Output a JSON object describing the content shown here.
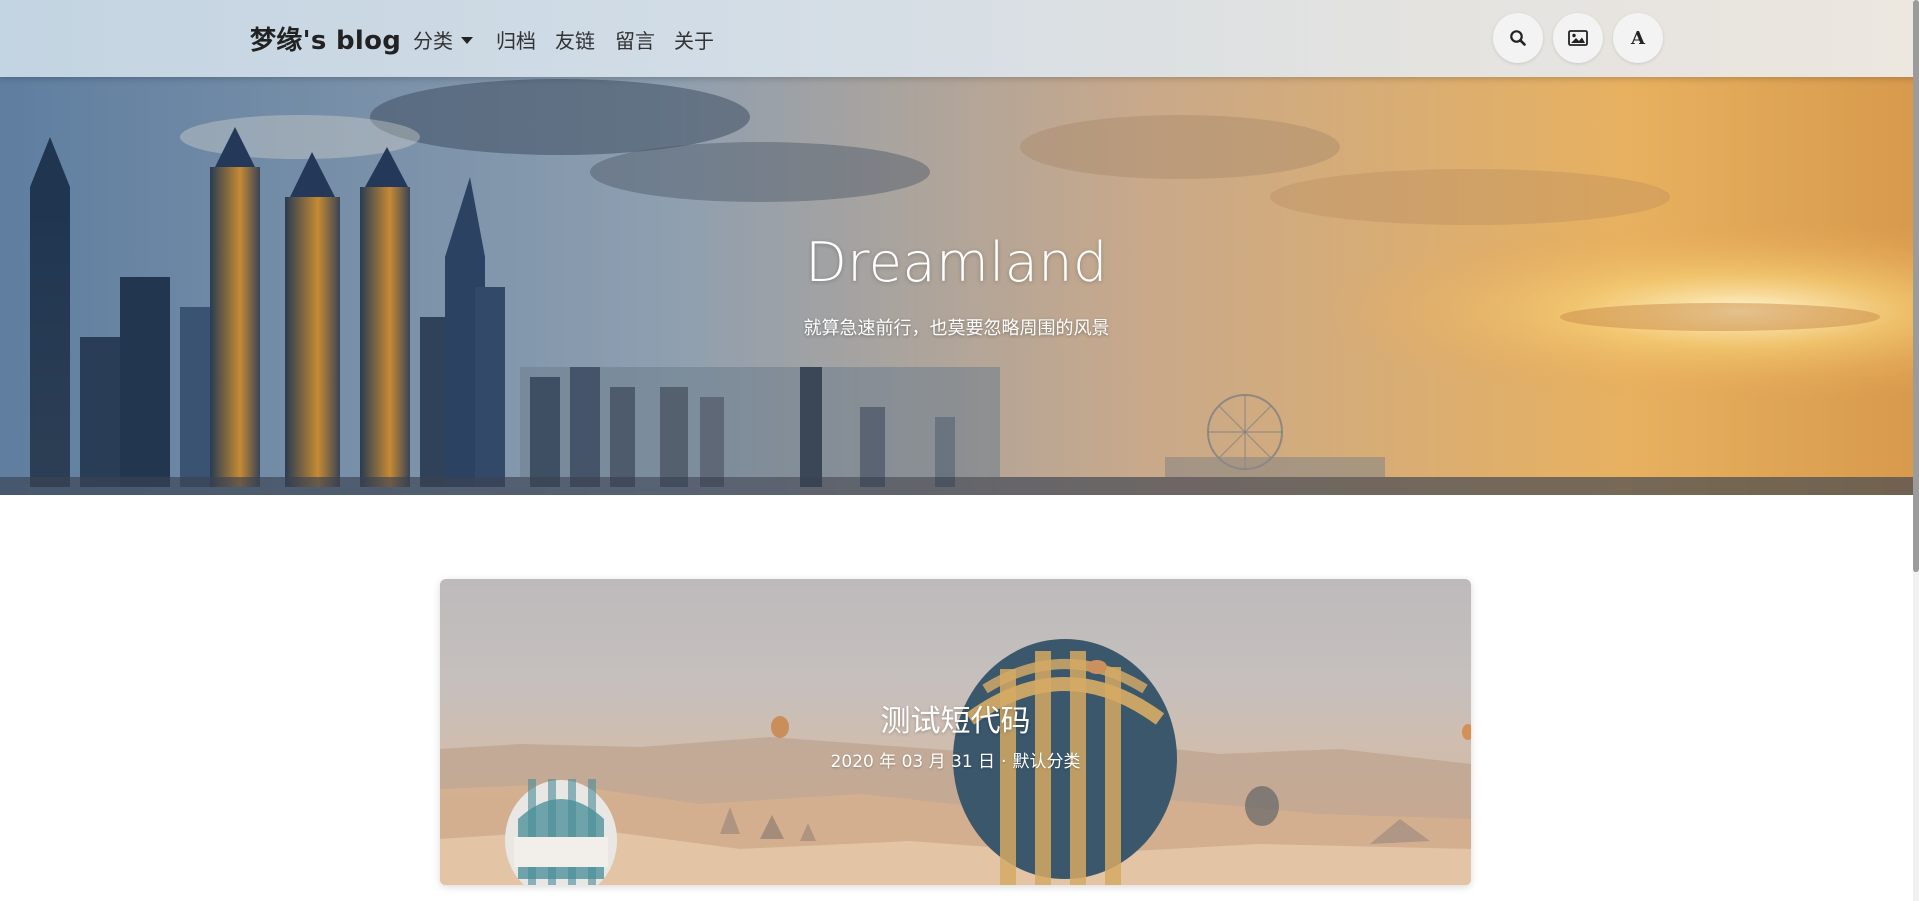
{
  "navbar": {
    "brand": "梦缘's blog",
    "items": [
      {
        "label": "分类",
        "has_dropdown": true
      },
      {
        "label": "归档"
      },
      {
        "label": "友链"
      },
      {
        "label": "留言"
      },
      {
        "label": "关于"
      }
    ],
    "buttons": {
      "search_icon": "search-icon",
      "image_icon": "image-icon",
      "font_label": "A"
    }
  },
  "hero": {
    "title": "Dreamland",
    "subtitle": "就算急速前行，也莫要忽略周围的风景"
  },
  "posts": [
    {
      "title": "测试短代码",
      "date": "2020 年 03 月 31 日",
      "separator": "·",
      "category": "默认分类"
    }
  ],
  "colors": {
    "text_dark": "#222222",
    "white": "#ffffff"
  }
}
